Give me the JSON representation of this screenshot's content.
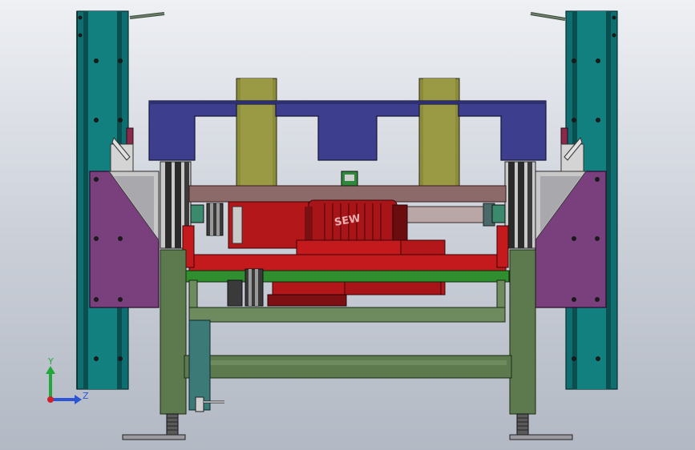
{
  "viewport": {
    "background_top": "#eef0f4",
    "background_bottom": "#b3b9c4"
  },
  "colors": {
    "column_teal": "#0f6f70",
    "column_teal_dark": "#0a4f50",
    "purple_plate": "#7a3f7d",
    "navy_frame": "#3d3f8e",
    "olive_post": "#8b8b3c",
    "green_frame": "#5d7a4f",
    "green_bar": "#2f8f2f",
    "red_motor": "#b3171a",
    "dark_red": "#7c0f12",
    "steel": "#8a8f98",
    "rod": "#b9a7a7"
  },
  "motor": {
    "brand_text": "SEW"
  },
  "triad": {
    "y_label": "Y",
    "z_label": "Z",
    "y_color": "#22a83a",
    "z_color": "#2a55d6",
    "origin_color": "#d0202a"
  }
}
